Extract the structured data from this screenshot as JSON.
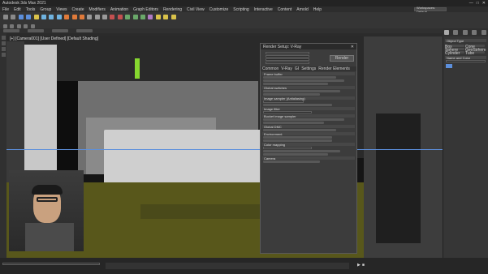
{
  "app": {
    "title": "Autodesk 3ds Max 2021",
    "menus": [
      "File",
      "Edit",
      "Tools",
      "Group",
      "Views",
      "Create",
      "Modifiers",
      "Animation",
      "Graph Editors",
      "Rendering",
      "Civil View",
      "Customize",
      "Scripting",
      "Interactive",
      "Content",
      "Arnold",
      "Help"
    ],
    "workspace": "Workspaces: Default"
  },
  "viewport": {
    "label": "[+] [Camera001] [User Defined] [Default Shading]"
  },
  "render_setup": {
    "title": "Render Setup: V-Ray",
    "render_button": "Render",
    "tabs": [
      "Common",
      "V-Ray",
      "GI",
      "Settings",
      "Render Elements"
    ],
    "sections": [
      "Frame buffer",
      "Global switches",
      "Image sampler (Antialiasing)",
      "Image filter",
      "Bucket image sampler",
      "Global DMC",
      "Environment",
      "Color mapping",
      "Camera"
    ]
  },
  "command_panel": {
    "sections": [
      "Object Type",
      "Name and Color"
    ],
    "items": [
      "Box",
      "Cone",
      "Sphere",
      "GeoSphere",
      "Cylinder",
      "Tube",
      "Torus",
      "Pyramid",
      "Teapot",
      "Plane",
      "TextPlus"
    ]
  },
  "colors": {
    "wall": "#6f6f6f",
    "floor": "#58571b",
    "accent": "#5c8fdc"
  }
}
